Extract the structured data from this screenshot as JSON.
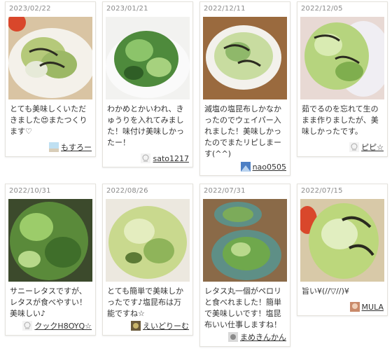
{
  "reports": [
    {
      "date": "2023/02/22",
      "comment": "とても美味しくいただきました😍またつくります♡",
      "author": "もすろー",
      "avatar": "landscape-avatar",
      "photo": "salad-photo"
    },
    {
      "date": "2023/01/21",
      "comment": "わかめとかいわれ、きゅうりを入れてみました！味付け美味しかったー！",
      "author": "sato1217",
      "avatar": "default-chef-avatar",
      "photo": "salad-photo"
    },
    {
      "date": "2022/12/11",
      "comment": "滅塩の塩昆布しかなかったのでウェイパー入れました！美味しかったのでまたリピしまーす(^^)",
      "author": "nao0505",
      "avatar": "blue-avatar",
      "photo": "salad-photo"
    },
    {
      "date": "2022/12/05",
      "comment": "茹でるのを忘れて生のまま作りましたが、美味しかったです。",
      "author": "ピピ☆",
      "avatar": "default-chef-avatar",
      "photo": "salad-photo"
    },
    {
      "date": "2022/10/31",
      "comment": "サニーレタスですが、レタスが食べやすい！美味しい♪",
      "author": "クックH8OYQ☆",
      "avatar": "default-chef-avatar",
      "photo": "salad-photo"
    },
    {
      "date": "2022/08/26",
      "comment": "とても簡単で美味しかったです♪塩昆布は万能ですね☆",
      "author": "えいどりーむ",
      "avatar": "photo-avatar",
      "photo": "salad-photo"
    },
    {
      "date": "2022/07/31",
      "comment": "レタス丸一個がペロリと食べれました！簡単で美味しいです！塩昆布いい仕事しますね！",
      "author": "まめきんかん",
      "avatar": "photo-avatar",
      "photo": "salad-photo"
    },
    {
      "date": "2022/07/15",
      "comment": "旨い¥(//▽//)¥",
      "author": "MULA",
      "avatar": "photo-avatar",
      "photo": "salad-photo"
    }
  ]
}
